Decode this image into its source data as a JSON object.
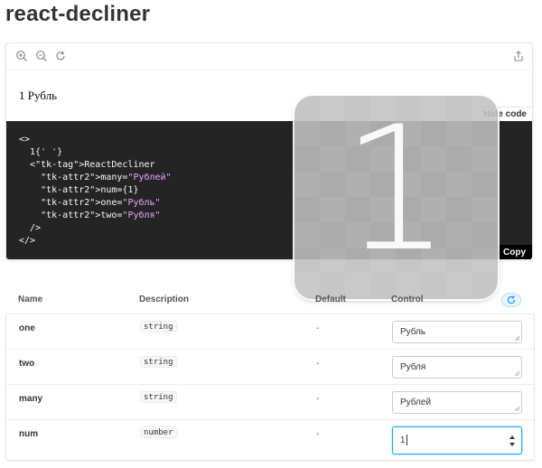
{
  "page": {
    "title": "react-decliner"
  },
  "toolbar": {
    "zoom_in_icon": "zoom-in-icon",
    "zoom_out_icon": "zoom-out-icon",
    "reset_zoom_icon": "refresh-icon",
    "share_icon": "share-icon"
  },
  "preview": {
    "rendered_text": "1 Рубль",
    "hide_code_label": "Hide code",
    "copy_label": "Copy",
    "code_lines": [
      "<>",
      "  1{' '}",
      "  <ReactDecliner",
      "    many=\"Рублей\"",
      "    num={1}",
      "    one=\"Рубль\"",
      "    two=\"Рубля\"",
      "  />",
      "</>"
    ]
  },
  "overlay": {
    "number": "1"
  },
  "args": {
    "headers": {
      "name": "Name",
      "description": "Description",
      "default": "Default",
      "control": "Control"
    },
    "rows": [
      {
        "name": "one",
        "type": "string",
        "default": "-",
        "value": "Рубль"
      },
      {
        "name": "two",
        "type": "string",
        "default": "-",
        "value": "Рубля"
      },
      {
        "name": "many",
        "type": "string",
        "default": "-",
        "value": "Рублей"
      },
      {
        "name": "num",
        "type": "number",
        "default": "-",
        "value": "1"
      }
    ]
  },
  "colors": {
    "accent": "#1ea7fd",
    "code_bg": "#242424"
  }
}
